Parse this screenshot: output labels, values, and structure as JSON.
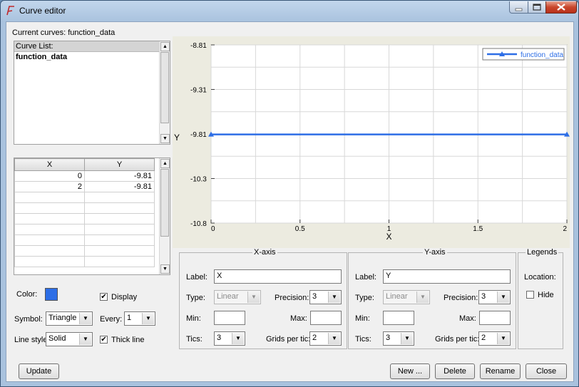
{
  "window": {
    "title": "Curve editor"
  },
  "current_curves": "Current curves: function_data",
  "curve_list": {
    "header": "Curve List:",
    "items": [
      "function_data"
    ]
  },
  "data_table": {
    "columns": [
      "X",
      "Y"
    ],
    "rows": [
      [
        "0",
        "-9.81"
      ],
      [
        "2",
        "-9.81"
      ],
      [
        "",
        ""
      ],
      [
        "",
        ""
      ],
      [
        "",
        ""
      ],
      [
        "",
        ""
      ],
      [
        "",
        ""
      ],
      [
        "",
        ""
      ],
      [
        "",
        ""
      ]
    ]
  },
  "style": {
    "color_label": "Color:",
    "color_value": "#2d6ee6",
    "display_label": "Display",
    "display_checked": true,
    "symbol_label": "Symbol:",
    "symbol_value": "Triangle",
    "every_label": "Every:",
    "every_value": "1",
    "line_style_label": "Line style:",
    "line_style_value": "Solid",
    "thick_line_label": "Thick line",
    "thick_line_checked": true
  },
  "xaxis": {
    "group": "X-axis",
    "label_label": "Label:",
    "label_value": "X",
    "type_label": "Type:",
    "type_value": "Linear",
    "precision_label": "Precision:",
    "precision_value": "3",
    "min_label": "Min:",
    "min_value": "",
    "max_label": "Max:",
    "max_value": "",
    "tics_label": "Tics:",
    "tics_value": "3",
    "grids_label": "Grids per tic:",
    "grids_value": "2"
  },
  "yaxis": {
    "group": "Y-axis",
    "label_label": "Label:",
    "label_value": "Y",
    "type_label": "Type:",
    "type_value": "Linear",
    "precision_label": "Precision:",
    "precision_value": "3",
    "min_label": "Min:",
    "min_value": "",
    "max_label": "Max:",
    "max_value": "",
    "tics_label": "Tics:",
    "tics_value": "3",
    "grids_label": "Grids per tic:",
    "grids_value": "2"
  },
  "legends": {
    "group": "Legends",
    "location_label": "Location:",
    "hide_label": "Hide",
    "hide_checked": false
  },
  "buttons": {
    "update": "Update",
    "new": "New ...",
    "delete": "Delete",
    "rename": "Rename",
    "close": "Close"
  },
  "chart_data": {
    "type": "line",
    "xlabel": "X",
    "ylabel": "Y",
    "xlim": [
      0,
      2
    ],
    "ylim": [
      -10.8,
      -8.81
    ],
    "xticks": [
      "0",
      "0.5",
      "1",
      "1.5",
      "2"
    ],
    "yticks": [
      "-8.81",
      "-9.31",
      "-9.81",
      "-10.3",
      "-10.8"
    ],
    "grid": true,
    "legend": "top-right",
    "series": [
      {
        "name": "function_data",
        "x": [
          0,
          2
        ],
        "y": [
          -9.81,
          -9.81
        ],
        "color": "#2d6ee6",
        "marker": "triangle"
      }
    ]
  }
}
